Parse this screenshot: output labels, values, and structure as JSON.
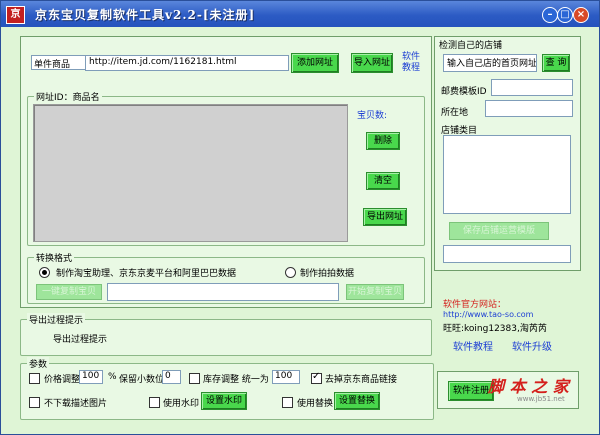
{
  "window": {
    "title": "京东宝贝复制软件工具v2.2-[未注册]"
  },
  "top": {
    "mode_select": "单件商品",
    "url_value": "http://item.jd.com/1162181.html",
    "add_url": "添加网址",
    "import_url": "导入网址",
    "tutorial": "软件\n教程"
  },
  "list": {
    "group_title": "网址ID：商品名",
    "count_label": "宝贝数:",
    "delete": "删除",
    "clear": "清空",
    "export_url": "导出网址"
  },
  "convert": {
    "group_title": "转换格式",
    "option1": "制作淘宝助理、京东京麦平台和阿里巴巴数据",
    "option2": "制作拍拍数据",
    "btn_left": "一键复制宝贝",
    "btn_right": "开始复制宝贝"
  },
  "export": {
    "group_title": "导出过程提示",
    "text": "导出过程提示"
  },
  "params": {
    "group_title": "参数",
    "price_adjust": "价格调整",
    "price_value": "100",
    "percent": "%",
    "decimals_label": "保留小数位",
    "decimals_value": "0",
    "stock_label": "库存调整 统一为",
    "stock_value": "100",
    "remove_link": "去掉京东商品链接",
    "no_desc_img": "不下载描述图片",
    "use_watermark": "使用水印",
    "set_watermark": "设置水印",
    "use_replace": "使用替换",
    "set_replace": "设置替换"
  },
  "shop": {
    "group_title": "检测自己的店铺",
    "url_input": "输入自己店的首页网址",
    "query": "查 询",
    "postage_label": "邮费模板ID",
    "location_label": "所在地",
    "category_label": "店铺类目",
    "save_btn": "保存店铺运营模版",
    "site_label": "软件官方网站：",
    "site_url": "http://www.tao-so.com",
    "wangwang": "旺旺:koing12383,淘芮芮",
    "tutorial_link": "软件教程",
    "upgrade_link": "软件升级",
    "register": "软件注册"
  },
  "watermark": {
    "main": "脚 本 之 家",
    "sub": "www.jb51.net"
  }
}
